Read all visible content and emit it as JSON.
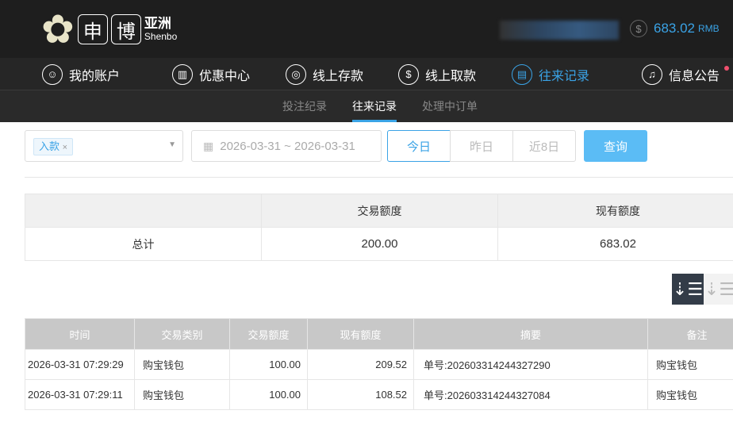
{
  "brand": {
    "name_cn_1": "申",
    "name_cn_2": "博",
    "name_cn_3": "亚洲",
    "name_en": "Shenbo"
  },
  "account": {
    "balance": "683.02",
    "currency": "RMB"
  },
  "nav": [
    {
      "label": "我的账户",
      "icon": "user-icon"
    },
    {
      "label": "优惠中心",
      "icon": "gift-icon"
    },
    {
      "label": "线上存款",
      "icon": "deposit-icon"
    },
    {
      "label": "线上取款",
      "icon": "withdraw-icon"
    },
    {
      "label": "往来记录",
      "icon": "records-icon",
      "active": true
    },
    {
      "label": "信息公告",
      "icon": "bell-icon",
      "badge": true
    }
  ],
  "subnav": [
    {
      "label": "投注纪录"
    },
    {
      "label": "往来记录",
      "active": true
    },
    {
      "label": "处理中订单"
    }
  ],
  "filter": {
    "type_tag": "入款",
    "date_range": "2026-03-31 ~ 2026-03-31",
    "today": "今日",
    "yesterday": "昨日",
    "last8": "近8日",
    "query": "查询"
  },
  "summary": {
    "headers": [
      "",
      "交易额度",
      "现有额度"
    ],
    "row": [
      "总计",
      "200.00",
      "683.02"
    ]
  },
  "table": {
    "headers": [
      "时间",
      "交易类别",
      "交易额度",
      "现有额度",
      "摘要",
      "备注"
    ],
    "rows": [
      [
        "2026-03-31 07:29:29",
        "购宝钱包",
        "100.00",
        "209.52",
        "单号:202603314244327290",
        "购宝钱包"
      ],
      [
        "2026-03-31 07:29:11",
        "购宝钱包",
        "100.00",
        "108.52",
        "单号:202603314244327084",
        "购宝钱包"
      ]
    ]
  },
  "colors": {
    "accent": "#3aa3e6",
    "header_bg": "#1e1e1e",
    "table_head": "#c8c8c8",
    "query_btn": "#5bbcf5"
  }
}
